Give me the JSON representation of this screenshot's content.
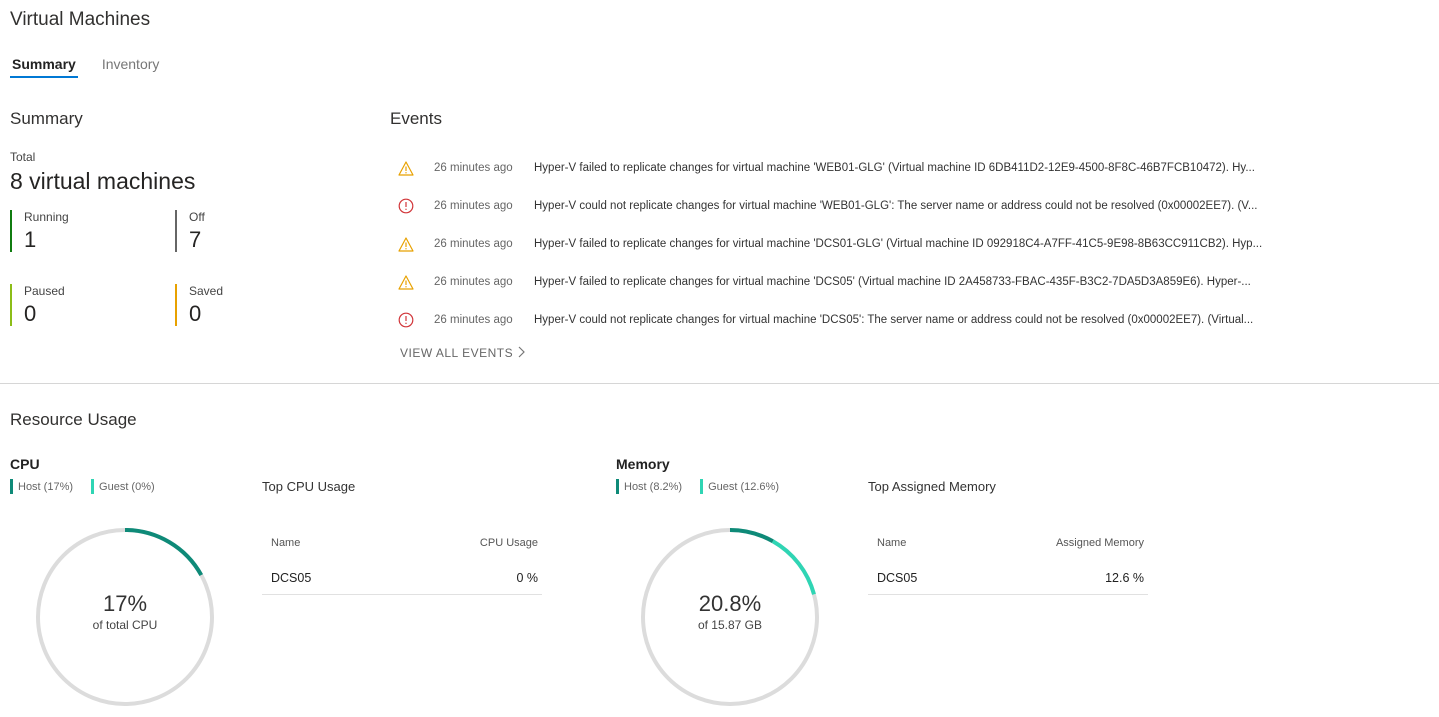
{
  "title": "Virtual Machines",
  "tabs": [
    {
      "label": "Summary",
      "active": true
    },
    {
      "label": "Inventory",
      "active": false
    }
  ],
  "summary": {
    "title": "Summary",
    "total_label": "Total",
    "total_value": "8 virtual machines",
    "stats": [
      {
        "label": "Running",
        "value": "1",
        "color": "#107c10"
      },
      {
        "label": "Off",
        "value": "7",
        "color": "#666666"
      },
      {
        "label": "Paused",
        "value": "0",
        "color": "#8cbd18"
      },
      {
        "label": "Saved",
        "value": "0",
        "color": "#e8a100"
      }
    ]
  },
  "events": {
    "title": "Events",
    "items": [
      {
        "type": "warning",
        "icon": "warning-icon",
        "time": "26 minutes ago",
        "message": "Hyper-V failed to replicate changes for virtual machine 'WEB01-GLG' (Virtual machine ID 6DB411D2-12E9-4500-8F8C-46B7FCB10472). Hy..."
      },
      {
        "type": "error",
        "icon": "error-icon",
        "time": "26 minutes ago",
        "message": "Hyper-V could not replicate changes for virtual machine 'WEB01-GLG': The server name or address could not be resolved (0x00002EE7). (V..."
      },
      {
        "type": "warning",
        "icon": "warning-icon",
        "time": "26 minutes ago",
        "message": "Hyper-V failed to replicate changes for virtual machine 'DCS01-GLG' (Virtual machine ID 092918C4-A7FF-41C5-9E98-8B63CC911CB2). Hyp..."
      },
      {
        "type": "warning",
        "icon": "warning-icon",
        "time": "26 minutes ago",
        "message": "Hyper-V failed to replicate changes for virtual machine 'DCS05' (Virtual machine ID 2A458733-FBAC-435F-B3C2-7DA5D3A859E6). Hyper-..."
      },
      {
        "type": "error",
        "icon": "error-icon",
        "time": "26 minutes ago",
        "message": "Hyper-V could not replicate changes for virtual machine 'DCS05': The server name or address could not be resolved (0x00002EE7). (Virtual..."
      }
    ],
    "view_all": "VIEW ALL EVENTS"
  },
  "resource_usage": {
    "title": "Resource Usage",
    "cpu": {
      "title": "CPU",
      "legend": [
        {
          "label": "Host (17%)",
          "color": "#0e8a78"
        },
        {
          "label": "Guest (0%)",
          "color": "#2fd5b4"
        }
      ],
      "host_fraction": 0.17,
      "guest_fraction": 0.0,
      "donut_value": "17%",
      "donut_sub": "of total CPU",
      "top_title": "Top CPU Usage",
      "table": {
        "headers": [
          "Name",
          "CPU Usage"
        ],
        "rows": [
          [
            "DCS05",
            "0 %"
          ]
        ]
      }
    },
    "memory": {
      "title": "Memory",
      "legend": [
        {
          "label": "Host (8.2%)",
          "color": "#0e8a78"
        },
        {
          "label": "Guest (12.6%)",
          "color": "#2fd5b4"
        }
      ],
      "host_fraction": 0.082,
      "guest_fraction": 0.126,
      "donut_value": "20.8%",
      "donut_sub": "of 15.87 GB",
      "top_title": "Top Assigned Memory",
      "table": {
        "headers": [
          "Name",
          "Assigned Memory"
        ],
        "rows": [
          [
            "DCS05",
            "12.6 %"
          ]
        ]
      }
    }
  }
}
